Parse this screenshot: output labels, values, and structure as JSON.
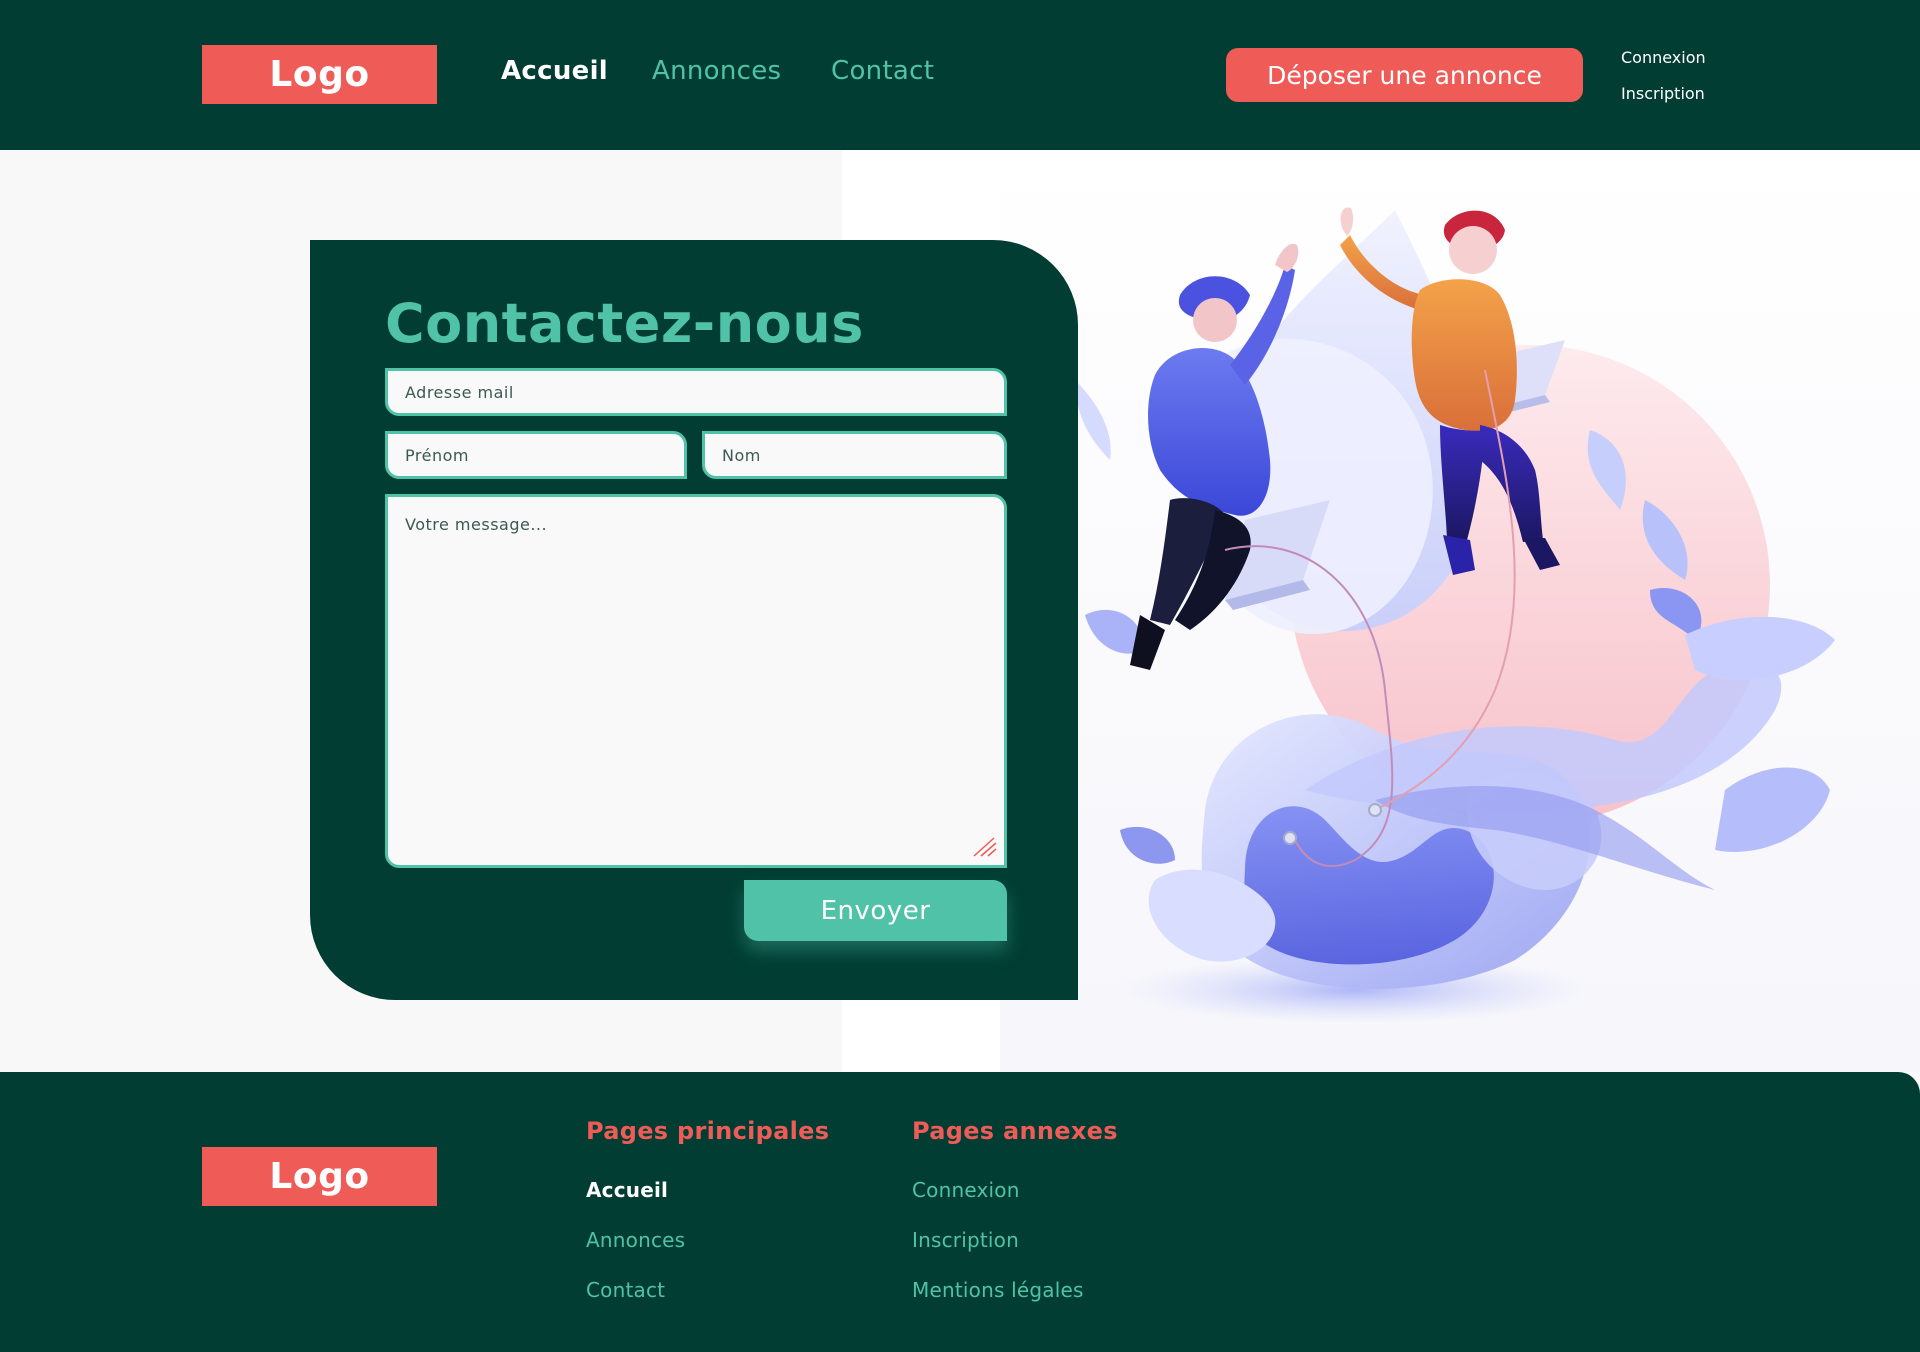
{
  "header": {
    "logo": "Logo",
    "nav": [
      {
        "label": "Accueil"
      },
      {
        "label": "Annonces"
      },
      {
        "label": "Contact"
      }
    ],
    "cta_label": "Déposer une annonce",
    "login_label": "Connexion",
    "signup_label": "Inscription"
  },
  "contact": {
    "title": "Contactez-nous",
    "email_placeholder": "Adresse mail",
    "firstname_placeholder": "Prénom",
    "lastname_placeholder": "Nom",
    "message_placeholder": "Votre message...",
    "submit_label": "Envoyer"
  },
  "footer": {
    "logo": "Logo",
    "columns": [
      {
        "title": "Pages principales",
        "links": [
          "Accueil",
          "Annonces",
          "Contact"
        ]
      },
      {
        "title": "Pages annexes",
        "links": [
          "Connexion",
          "Inscription",
          "Mentions légales"
        ]
      }
    ]
  },
  "colors": {
    "dark_green": "#013d33",
    "teal": "#4fc2a8",
    "coral": "#ef5b57",
    "light_bg": "#f9f9f9"
  },
  "icons": {
    "illustration": "two-people-jumping-with-laptops-illustration",
    "resize": "textarea-resize-grip-icon"
  }
}
